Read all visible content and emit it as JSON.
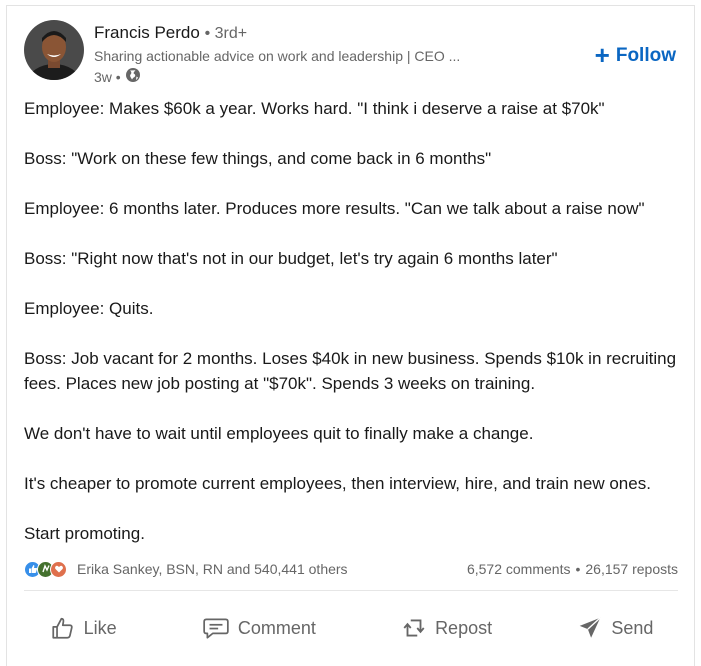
{
  "post": {
    "author": {
      "name": "Francis Perdo",
      "degree": "• 3rd+",
      "headline": "Sharing actionable advice on work and leadership | CEO ...",
      "time": "3w •",
      "visibility_icon": "globe-icon"
    },
    "follow_label": "Follow",
    "body": [
      "Employee: Makes $60k a year. Works hard. \"I think i deserve a raise at $70k\"",
      "Boss: \"Work on these few things, and come back in 6 months\"",
      "Employee: 6 months later. Produces more results. \"Can we talk about a raise now\"",
      "Boss: \"Right now that's not in our budget, let's try again 6 months later\"",
      "Employee: Quits.",
      "Boss: Job vacant for 2 months. Loses $40k in new business. Spends $10k in recruiting fees. Places new job posting at \"$70k\". Spends 3 weeks on training.",
      "We don't have to wait until employees quit to finally make a change.",
      "It's cheaper to promote current employees, then interview, hire, and train new ones.",
      "Start promoting."
    ],
    "social": {
      "reactions": [
        "like-icon",
        "celebrate-icon",
        "love-icon"
      ],
      "reactors_text": "Erika Sankey, BSN, RN and 540,441 others",
      "comments": "6,572 comments",
      "separator": "•",
      "reposts": "26,157 reposts"
    },
    "actions": [
      {
        "label": "Like",
        "icon": "like-thumb-icon"
      },
      {
        "label": "Comment",
        "icon": "comment-icon"
      },
      {
        "label": "Repost",
        "icon": "repost-icon"
      },
      {
        "label": "Send",
        "icon": "send-icon"
      }
    ],
    "colors": {
      "accent": "#0a66c2",
      "muted_text": "#666666",
      "like": "#378fe9",
      "celebrate": "#44712e",
      "love": "#df704d"
    }
  }
}
